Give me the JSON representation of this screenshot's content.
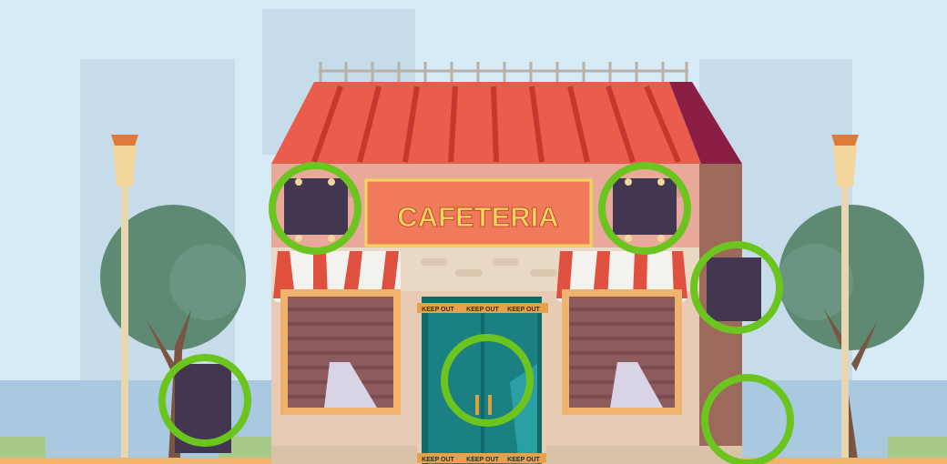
{
  "scene": {
    "sign_text": "CAFETERIA",
    "tape_text": "KEEP OUT"
  },
  "colors": {
    "sky": "#d7ebf7",
    "roof": "#e9574a",
    "sign_bg": "#f07a5a",
    "sign_text": "#f6d65a",
    "wall": "#9c6a5a",
    "marker": "#6cc41e"
  },
  "found_differences": [
    {
      "name": "left-sign-window"
    },
    {
      "name": "right-sign-window"
    },
    {
      "name": "side-wall-window"
    },
    {
      "name": "door-handles"
    },
    {
      "name": "sidewalk-chalkboard"
    },
    {
      "name": "wall-corner"
    }
  ]
}
